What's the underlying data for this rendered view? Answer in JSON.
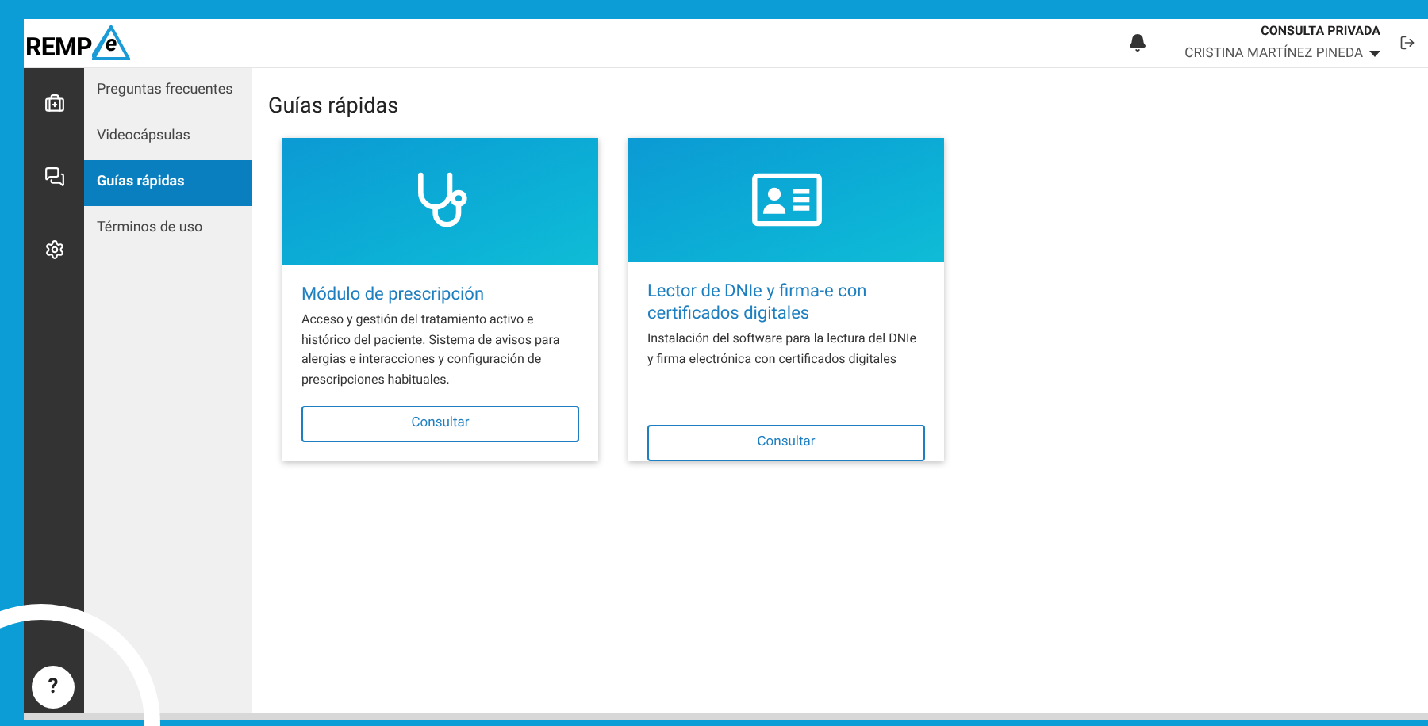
{
  "header": {
    "logo": {
      "text": "REMP",
      "mark": "e"
    },
    "practice": "CONSULTA PRIVADA",
    "user": "CRISTINA MARTÍNEZ PINEDA"
  },
  "rail": [
    {
      "kind": "kit"
    },
    {
      "kind": "chat"
    },
    {
      "kind": "gear"
    }
  ],
  "help": "?",
  "submenu": [
    {
      "label": "Preguntas frecuentes",
      "selected": false
    },
    {
      "label": "Videocápsulas",
      "selected": false
    },
    {
      "label": "Guías rápidas",
      "selected": true
    },
    {
      "label": "Términos de uso",
      "selected": false
    }
  ],
  "page_title": "Guías rápidas",
  "cards": [
    {
      "kind": "stethoscope",
      "title": "Módulo de prescripción",
      "text": "Acceso y gestión del tratamiento activo e histórico del paciente. Sistema de avisos para alergias e interacciones y configuración de prescripciones habituales.",
      "button": "Consultar"
    },
    {
      "kind": "idcard",
      "title": "Lector de DNIe y firma-e con certificados digitales",
      "text": "Instalación del software para la lectura del DNIe y firma electrónica con certificados digitales",
      "button": "Consultar"
    }
  ]
}
